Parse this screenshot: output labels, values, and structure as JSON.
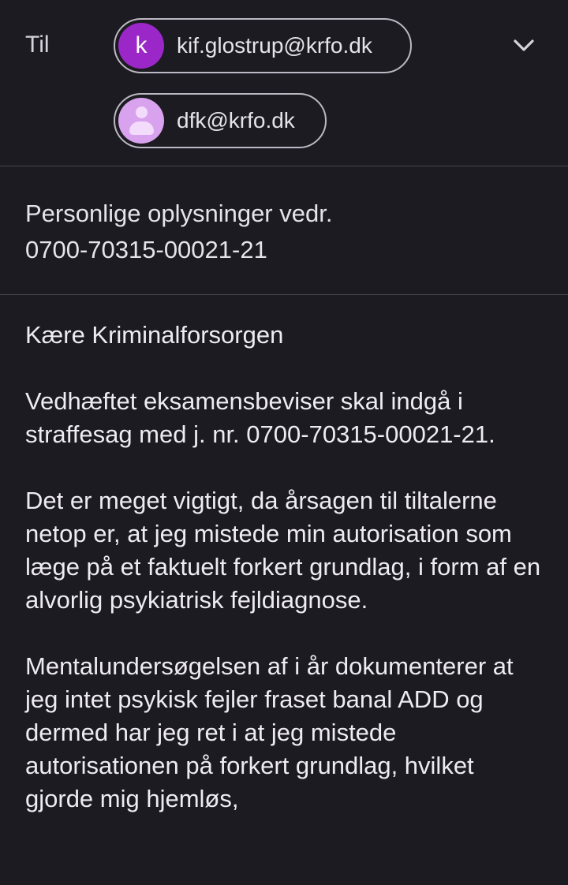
{
  "header": {
    "to_label": "Til",
    "recipients": [
      {
        "avatar_letter": "k",
        "email": "kif.glostrup@krfo.dk",
        "avatar_color": "#9c27c9"
      },
      {
        "avatar_letter": "",
        "email": "dfk@krfo.dk",
        "avatar_color": "#d9a2ee",
        "avatar_icon": "person-icon"
      }
    ],
    "expand_icon": "chevron-down-icon"
  },
  "subject": {
    "line1": "Personlige oplysninger vedr.",
    "line2": "0700-70315-00021-21"
  },
  "body": {
    "greeting": "Kære Kriminalforsorgen",
    "paragraphs": [
      "Vedhæftet eksamensbeviser skal indgå i straffesag med j. nr. 0700-70315-00021-21.",
      "Det er meget vigtigt, da årsagen til tiltalerne netop er, at jeg mistede min autorisation som læge på et faktuelt forkert grundlag, i form af en alvorlig psykiatrisk fejldiagnose.",
      "Mentalundersøgelsen af i år dokumenterer at jeg intet psykisk fejler fraset banal ADD og dermed har jeg ret i at jeg mistede autorisationen på forkert grundlag, hvilket gjorde mig hjemløs,"
    ]
  },
  "colors": {
    "background": "#1c1b22",
    "text": "#e6e3ea",
    "divider": "#45434b",
    "chip_border": "#bdb9c4"
  }
}
